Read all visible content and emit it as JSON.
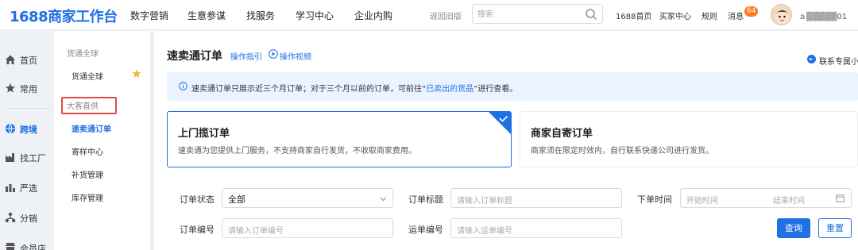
{
  "logo": "1688商家工作台",
  "topnav": [
    "数字营销",
    "生意参谋",
    "找服务",
    "学习中心",
    "企业内购"
  ],
  "old_version": "返回旧版",
  "search": {
    "placeholder": "搜索"
  },
  "toplinks": {
    "home": "1688首页",
    "buyer": "买家中心",
    "rules": "规则",
    "messages": "消息",
    "badge": "64"
  },
  "user": {
    "name": "ａ▒▒▒▒▒01"
  },
  "rail": [
    {
      "label": "首页",
      "icon": "home-icon"
    },
    {
      "label": "常用",
      "icon": "star-icon"
    },
    {
      "label": "跨境",
      "icon": "globe-icon"
    },
    {
      "label": "找工厂",
      "icon": "factory-icon"
    },
    {
      "label": "严选",
      "icon": "chart-icon"
    },
    {
      "label": "分销",
      "icon": "distribution-icon"
    },
    {
      "label": "会员店",
      "icon": "store-icon"
    }
  ],
  "submenu": {
    "group1": "货通全球",
    "item_global": "货通全球",
    "group2": "大客直供",
    "items": [
      "速卖通订单",
      "寄样中心",
      "补货管理",
      "库存管理"
    ]
  },
  "page": {
    "title": "速卖通订单",
    "guide": "操作指引",
    "video": "操作视频",
    "contact": "联系专属小二"
  },
  "notice": {
    "text_before": "速卖通订单只展示近三个月订单；对于三个月以前的订单，可前往“",
    "link": "已卖出的货品",
    "text_after": "”进行查看。"
  },
  "cards": [
    {
      "title": "上门揽订单",
      "desc": "速卖通为您提供上门服务，不支持商家自行发货，不收取商家费用。",
      "selected": true
    },
    {
      "title": "商家自寄订单",
      "desc": "商家须在限定时效内，自行联系快递公司进行发货。",
      "selected": false
    }
  ],
  "filters": {
    "status_label": "订单状态",
    "status_value": "全部",
    "title_label": "订单标题",
    "title_placeholder": "请输入订单标题",
    "time_label": "下单时间",
    "start_placeholder": "开始时间",
    "end_placeholder": "结束时间",
    "order_no_label": "订单编号",
    "order_no_placeholder": "请输入订单编号",
    "waybill_label": "运单编号",
    "waybill_placeholder": "请输入运单编号",
    "search_button": "查询",
    "reset_button": "重置"
  },
  "colors": {
    "brand": "#1f6fe5",
    "badge": "#ff7a1a",
    "highlight": "#e04848"
  }
}
